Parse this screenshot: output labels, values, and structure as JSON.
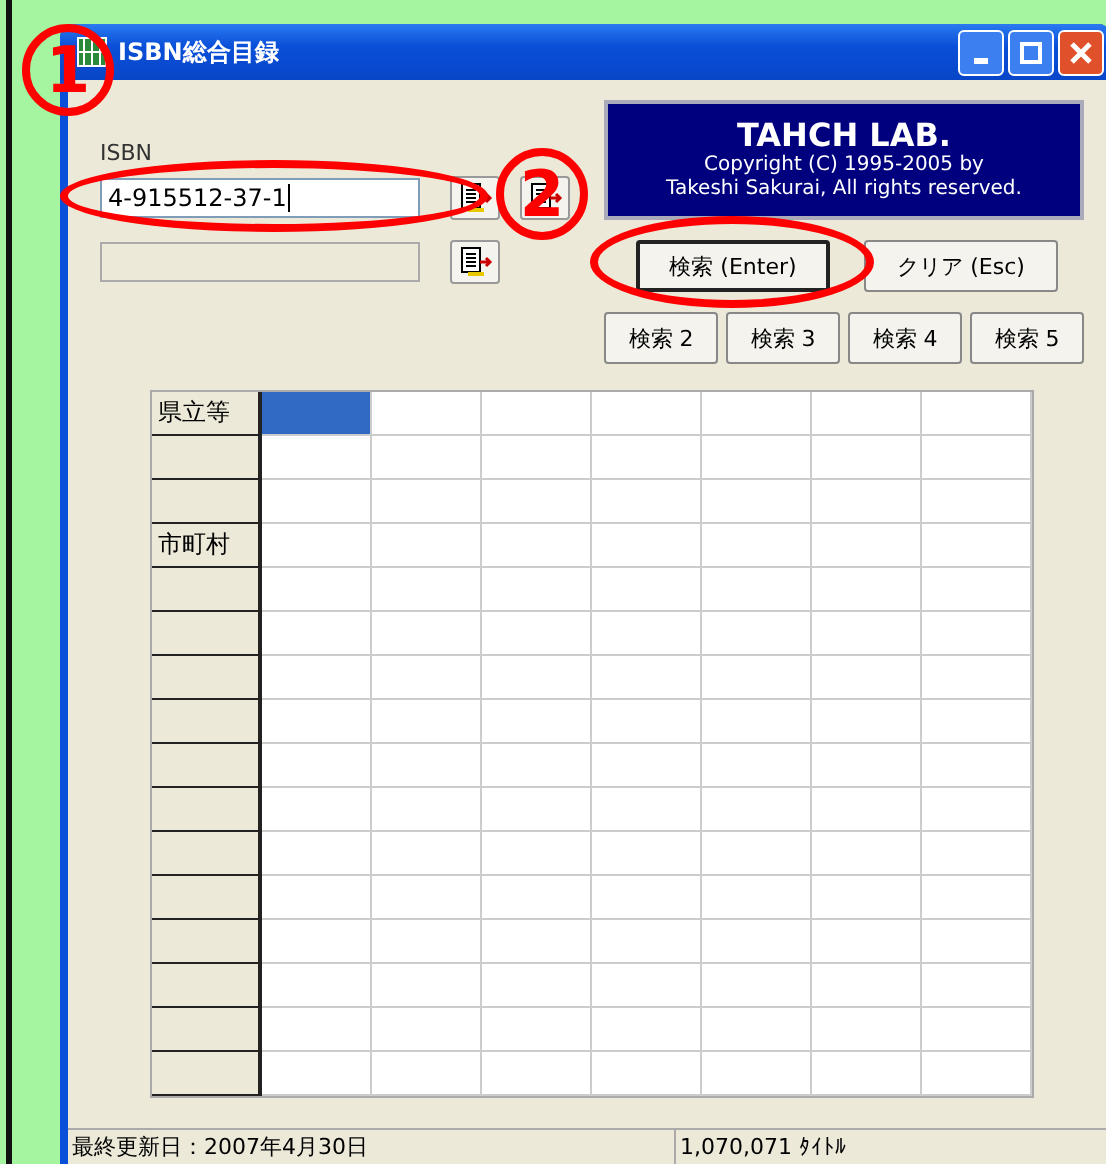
{
  "window": {
    "title": "ISBN総合目録"
  },
  "isbn": {
    "label": "ISBN",
    "value": "4-915512-37-1"
  },
  "result_field": {
    "disabled": true
  },
  "banner": {
    "title": "TAHCH LAB.",
    "lines": [
      "Copyright (C) 1995-2005 by",
      "Takeshi Sakurai, All rights reserved."
    ]
  },
  "action_buttons": [
    {
      "label": "検索 (Enter)",
      "default": true
    },
    {
      "label": "クリア (Esc)",
      "default": false
    }
  ],
  "search_buttons": [
    "検索 2",
    "検索 3",
    "検索 4",
    "検索 5"
  ],
  "grid": {
    "rows": [
      {
        "header": "県立等",
        "cells": [
          {
            "selected": true
          },
          {
            "selected": false
          },
          {
            "selected": false
          },
          {
            "selected": false
          },
          {
            "selected": false
          },
          {
            "selected": false
          },
          {
            "selected": false
          }
        ]
      },
      {
        "cells": [
          {
            "selected": false
          },
          {
            "selected": false
          },
          {
            "selected": false
          },
          {
            "selected": false
          },
          {
            "selected": false
          },
          {
            "selected": false
          },
          {
            "selected": false
          }
        ]
      },
      {
        "cells": [
          {
            "selected": false
          },
          {
            "selected": false
          },
          {
            "selected": false
          },
          {
            "selected": false
          },
          {
            "selected": false
          },
          {
            "selected": false
          },
          {
            "selected": false
          }
        ]
      },
      {
        "header": "市町村",
        "cells": [
          {
            "selected": false
          },
          {
            "selected": false
          },
          {
            "selected": false
          },
          {
            "selected": false
          },
          {
            "selected": false
          },
          {
            "selected": false
          },
          {
            "selected": false
          }
        ]
      },
      {
        "cells": [
          {
            "selected": false
          },
          {
            "selected": false
          },
          {
            "selected": false
          },
          {
            "selected": false
          },
          {
            "selected": false
          },
          {
            "selected": false
          },
          {
            "selected": false
          }
        ]
      },
      {
        "cells": [
          {
            "selected": false
          },
          {
            "selected": false
          },
          {
            "selected": false
          },
          {
            "selected": false
          },
          {
            "selected": false
          },
          {
            "selected": false
          },
          {
            "selected": false
          }
        ]
      },
      {
        "cells": [
          {
            "selected": false
          },
          {
            "selected": false
          },
          {
            "selected": false
          },
          {
            "selected": false
          },
          {
            "selected": false
          },
          {
            "selected": false
          },
          {
            "selected": false
          }
        ]
      },
      {
        "cells": [
          {
            "selected": false
          },
          {
            "selected": false
          },
          {
            "selected": false
          },
          {
            "selected": false
          },
          {
            "selected": false
          },
          {
            "selected": false
          },
          {
            "selected": false
          }
        ]
      },
      {
        "cells": [
          {
            "selected": false
          },
          {
            "selected": false
          },
          {
            "selected": false
          },
          {
            "selected": false
          },
          {
            "selected": false
          },
          {
            "selected": false
          },
          {
            "selected": false
          }
        ]
      },
      {
        "cells": [
          {
            "selected": false
          },
          {
            "selected": false
          },
          {
            "selected": false
          },
          {
            "selected": false
          },
          {
            "selected": false
          },
          {
            "selected": false
          },
          {
            "selected": false
          }
        ]
      },
      {
        "cells": [
          {
            "selected": false
          },
          {
            "selected": false
          },
          {
            "selected": false
          },
          {
            "selected": false
          },
          {
            "selected": false
          },
          {
            "selected": false
          },
          {
            "selected": false
          }
        ]
      },
      {
        "cells": [
          {
            "selected": false
          },
          {
            "selected": false
          },
          {
            "selected": false
          },
          {
            "selected": false
          },
          {
            "selected": false
          },
          {
            "selected": false
          },
          {
            "selected": false
          }
        ]
      },
      {
        "cells": [
          {
            "selected": false
          },
          {
            "selected": false
          },
          {
            "selected": false
          },
          {
            "selected": false
          },
          {
            "selected": false
          },
          {
            "selected": false
          },
          {
            "selected": false
          }
        ]
      },
      {
        "cells": [
          {
            "selected": false
          },
          {
            "selected": false
          },
          {
            "selected": false
          },
          {
            "selected": false
          },
          {
            "selected": false
          },
          {
            "selected": false
          },
          {
            "selected": false
          }
        ]
      },
      {
        "cells": [
          {
            "selected": false
          },
          {
            "selected": false
          },
          {
            "selected": false
          },
          {
            "selected": false
          },
          {
            "selected": false
          },
          {
            "selected": false
          },
          {
            "selected": false
          }
        ]
      },
      {
        "cells": [
          {
            "selected": false
          },
          {
            "selected": false
          },
          {
            "selected": false
          },
          {
            "selected": false
          },
          {
            "selected": false
          },
          {
            "selected": false
          },
          {
            "selected": false
          }
        ]
      }
    ]
  },
  "status_bar": [
    "最終更新日：2007年4月30日",
    "1,070,071 ﾀｲﾄﾙ"
  ],
  "annotations": [
    {
      "kind": "number",
      "label": "1"
    },
    {
      "kind": "ellipse"
    },
    {
      "kind": "number",
      "label": "2"
    },
    {
      "kind": "ellipse"
    }
  ]
}
